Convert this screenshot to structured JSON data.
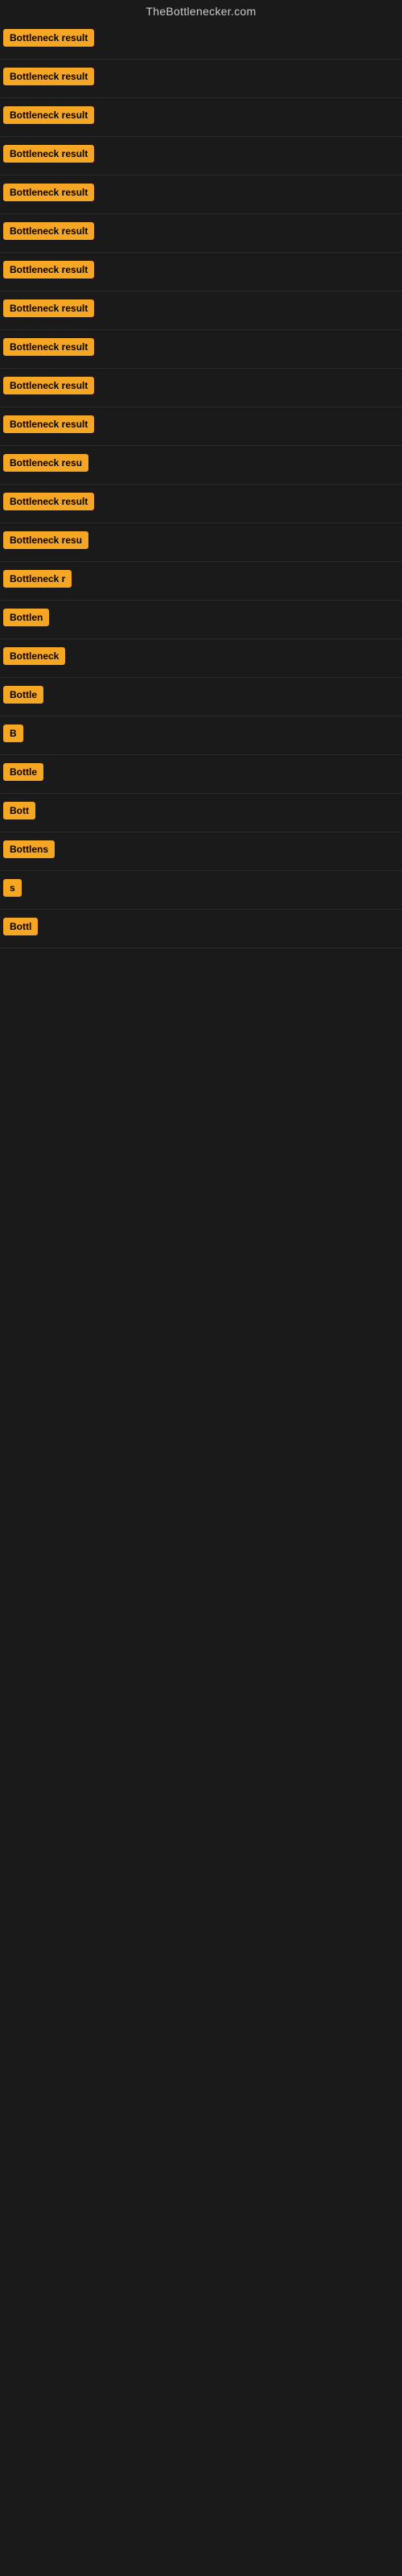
{
  "site": {
    "title": "TheBottlenecker.com"
  },
  "results": [
    {
      "id": 1,
      "label": "Bottleneck result",
      "visible_text": "Bottleneck result"
    },
    {
      "id": 2,
      "label": "Bottleneck result",
      "visible_text": "Bottleneck result"
    },
    {
      "id": 3,
      "label": "Bottleneck result",
      "visible_text": "Bottleneck result"
    },
    {
      "id": 4,
      "label": "Bottleneck result",
      "visible_text": "Bottleneck result"
    },
    {
      "id": 5,
      "label": "Bottleneck result",
      "visible_text": "Bottleneck result"
    },
    {
      "id": 6,
      "label": "Bottleneck result",
      "visible_text": "Bottleneck result"
    },
    {
      "id": 7,
      "label": "Bottleneck result",
      "visible_text": "Bottleneck result"
    },
    {
      "id": 8,
      "label": "Bottleneck result",
      "visible_text": "Bottleneck result"
    },
    {
      "id": 9,
      "label": "Bottleneck result",
      "visible_text": "Bottleneck result"
    },
    {
      "id": 10,
      "label": "Bottleneck result",
      "visible_text": "Bottleneck result"
    },
    {
      "id": 11,
      "label": "Bottleneck result",
      "visible_text": "Bottleneck result"
    },
    {
      "id": 12,
      "label": "Bottleneck resu",
      "visible_text": "Bottleneck resu"
    },
    {
      "id": 13,
      "label": "Bottleneck result",
      "visible_text": "Bottleneck result"
    },
    {
      "id": 14,
      "label": "Bottleneck resu",
      "visible_text": "Bottleneck resu"
    },
    {
      "id": 15,
      "label": "Bottleneck r",
      "visible_text": "Bottleneck r"
    },
    {
      "id": 16,
      "label": "Bottlen",
      "visible_text": "Bottlen"
    },
    {
      "id": 17,
      "label": "Bottleneck",
      "visible_text": "Bottleneck"
    },
    {
      "id": 18,
      "label": "Bottle",
      "visible_text": "Bottle"
    },
    {
      "id": 19,
      "label": "B",
      "visible_text": "B"
    },
    {
      "id": 20,
      "label": "Bottle",
      "visible_text": "Bottle"
    },
    {
      "id": 21,
      "label": "Bott",
      "visible_text": "Bott"
    },
    {
      "id": 22,
      "label": "Bottlens",
      "visible_text": "Bottlens"
    },
    {
      "id": 23,
      "label": "s",
      "visible_text": "s"
    },
    {
      "id": 24,
      "label": "Bottl",
      "visible_text": "Bottl"
    }
  ]
}
